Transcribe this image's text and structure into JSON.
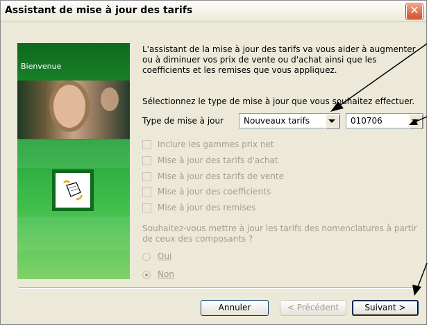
{
  "window": {
    "title": "Assistant de mise à jour des tarifs",
    "close_glyph": "✕"
  },
  "sidepanel": {
    "welcome": "Bienvenue",
    "image": "woman-portrait",
    "icon": "wizard-icon",
    "accent": "#25a13a"
  },
  "main": {
    "intro": "L'assistant de la mise à jour des tarifs va vous aider à augmenter ou à diminuer vos prix de vente ou d'achat ainsi que les coefficients et les remises que vous appliquez.",
    "select_prompt": "Sélectionnez le type de mise à jour que vous souhaitez effectuer.",
    "type_label": "Type de mise à jour",
    "type_value": "Nouveaux tarifs",
    "code_value": "010706",
    "checkboxes": [
      {
        "label": "Inclure les gammes prix net",
        "checked": false
      },
      {
        "label": "Mise à jour des tarifs d'achat",
        "checked": false
      },
      {
        "label": "Mise à jour des tarifs de vente",
        "checked": false
      },
      {
        "label": "Mise à jour des coefficients",
        "checked": false
      },
      {
        "label": "Mise à jour des remises",
        "checked": false
      }
    ],
    "question": "Souhaitez-vous mettre à jour les tarifs des nomenclatures à partir de ceux des composants ?",
    "radios": [
      {
        "label": "Oui",
        "selected": false
      },
      {
        "label": "Non",
        "selected": true
      }
    ]
  },
  "footer": {
    "cancel": "Annuler",
    "previous": "< Précédent",
    "next": "Suivant >"
  },
  "colors": {
    "titlebar": "#ece9d8",
    "close": "#d1502c",
    "disabled_text": "#a19e8f"
  }
}
